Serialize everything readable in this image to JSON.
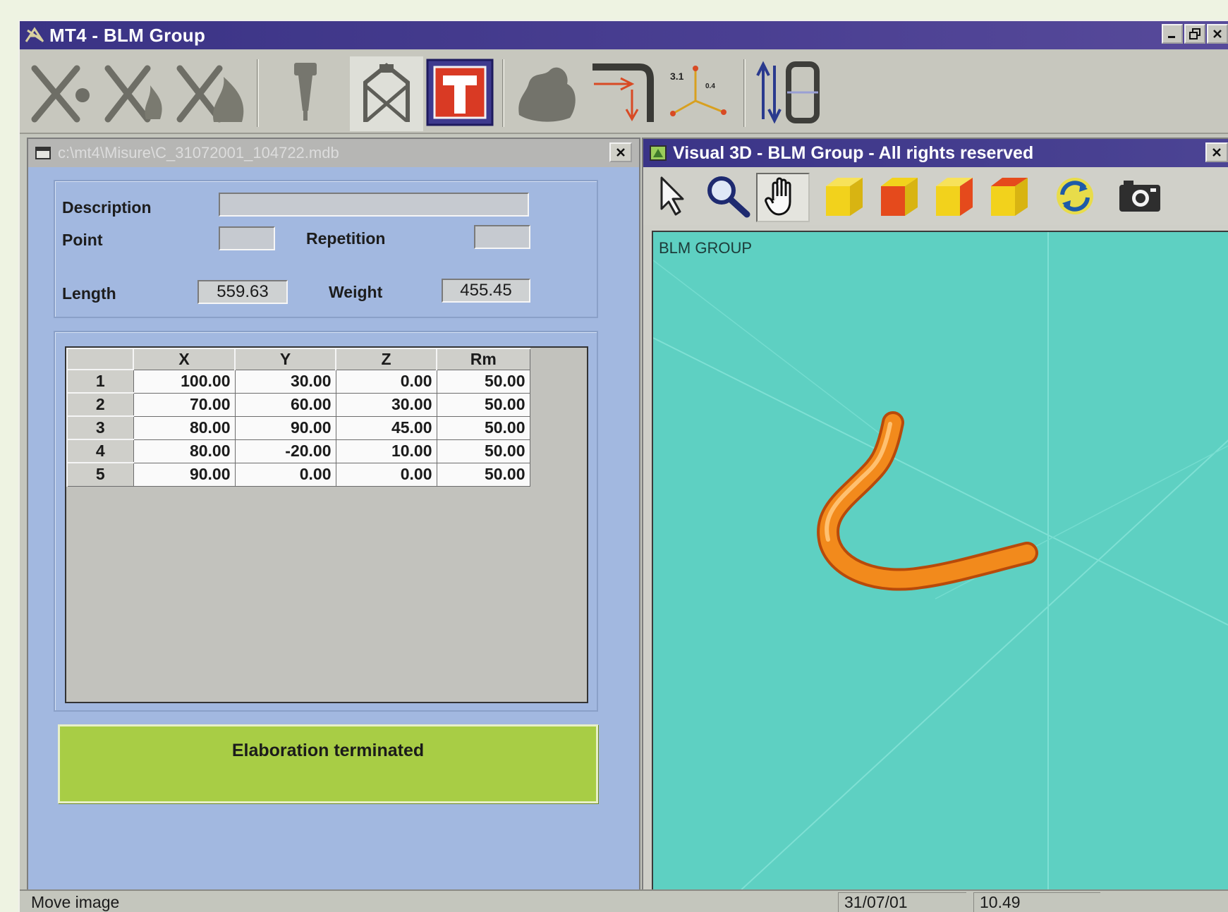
{
  "window": {
    "title": "MT4 - BLM Group",
    "controls": [
      "_",
      "ẞ",
      "×"
    ]
  },
  "toolbar": {
    "buttons": [
      {
        "icon": "cutting-tool-icon"
      },
      {
        "icon": "cutting-tool-flame-icon"
      },
      {
        "icon": "cutting-tool-large-icon"
      },
      {
        "icon": "probe-icon"
      },
      {
        "icon": "fixture-icon"
      },
      {
        "icon": "t-measure-icon",
        "selected": true
      },
      {
        "icon": "cloud-points-icon"
      },
      {
        "icon": "bend-dimensions-icon"
      },
      {
        "icon": "axes-3d-icon",
        "labels": [
          "3.1",
          "0.4"
        ]
      },
      {
        "icon": "tube-length-icon"
      }
    ]
  },
  "left_panel": {
    "title": "c:\\mt4\\Misure\\C_31072001_104722.mdb",
    "close": "×",
    "form": {
      "description_label": "Description",
      "description_value": "",
      "point_label": "Point",
      "point_value": "",
      "repetition_label": "Repetition",
      "repetition_value": "",
      "length_label": "Length",
      "length_value": "559.63",
      "weight_label": "Weight",
      "weight_value": "455.45"
    },
    "table": {
      "columns": [
        "",
        "X",
        "Y",
        "Z",
        "Rm"
      ],
      "rows": [
        [
          "1",
          "100.00",
          "30.00",
          "0.00",
          "50.00"
        ],
        [
          "2",
          "70.00",
          "60.00",
          "30.00",
          "50.00"
        ],
        [
          "3",
          "80.00",
          "90.00",
          "45.00",
          "50.00"
        ],
        [
          "4",
          "80.00",
          "-20.00",
          "10.00",
          "50.00"
        ],
        [
          "5",
          "90.00",
          "0.00",
          "0.00",
          "50.00"
        ]
      ]
    },
    "status_message": "Elaboration terminated"
  },
  "visual3d": {
    "title": "Visual 3D - BLM Group - All rights reserved",
    "close": "×",
    "tools": [
      {
        "icon": "pointer-icon"
      },
      {
        "icon": "zoom-icon"
      },
      {
        "icon": "pan-hand-icon",
        "selected": true
      },
      {
        "icon": "cube-view-iso-icon",
        "color": "#f2d21c"
      },
      {
        "icon": "cube-view-front-icon",
        "color": "#e54a1c"
      },
      {
        "icon": "cube-view-side-icon",
        "color": "#e8a01a"
      },
      {
        "icon": "cube-view-top-icon",
        "color": "#f0c81c"
      },
      {
        "icon": "rotate-icon"
      },
      {
        "icon": "camera-icon"
      }
    ],
    "viewport_label": "BLM GROUP",
    "background_color": "#5ed0c2",
    "tube_color": "#f28a1c"
  },
  "statusbar": {
    "message": "Move image",
    "date": "31/07/01",
    "time": "10.49"
  }
}
